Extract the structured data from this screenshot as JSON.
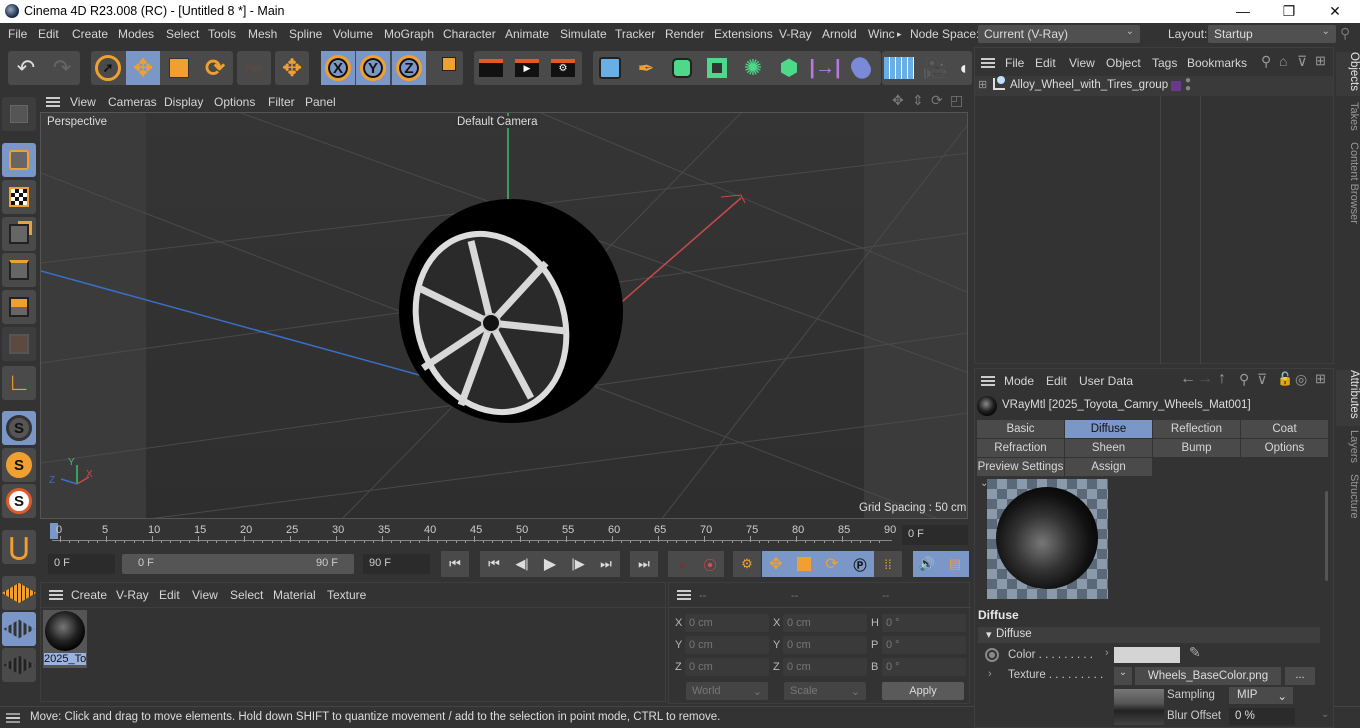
{
  "window": {
    "title": "Cinema 4D R23.008 (RC) - [Untitled 8 *] - Main",
    "minimize": "—",
    "maximize": "❐",
    "close": "✕"
  },
  "menubar": {
    "items": [
      "File",
      "Edit",
      "Create",
      "Modes",
      "Select",
      "Tools",
      "Mesh",
      "Spline",
      "Volume",
      "MoGraph",
      "Character",
      "Animate",
      "Simulate",
      "Tracker",
      "Render",
      "Extensions",
      "V-Ray",
      "Arnold",
      "Winc"
    ],
    "overflow_arrow": "▸",
    "node_space_label": "Node Space:",
    "node_space_value": "Current (V-Ray)",
    "layout_label": "Layout:",
    "layout_value": "Startup"
  },
  "toolbar": {
    "axis_x": "X",
    "axis_y": "Y",
    "axis_z": "Z",
    "psr": "PSR"
  },
  "viewport": {
    "menu": [
      "View",
      "Cameras",
      "Display",
      "Options",
      "Filter",
      "Panel"
    ],
    "view_name": "Perspective",
    "camera_name": "Default Camera",
    "grid_spacing": "Grid Spacing : 50 cm",
    "axis_labels": {
      "x": "X",
      "y": "Y",
      "z": "Z"
    },
    "colors": {
      "x_axis": "#c84a4a",
      "y_axis": "#3fbf6f",
      "z_axis": "#3a6fc8"
    }
  },
  "timeline": {
    "ticks": [
      "0",
      "5",
      "10",
      "15",
      "20",
      "25",
      "30",
      "35",
      "40",
      "45",
      "50",
      "55",
      "60",
      "65",
      "70",
      "75",
      "80",
      "85",
      "90"
    ],
    "current_frame_field": "0 F",
    "start_field": "0 F",
    "range_start": "0 F",
    "range_end": "90 F",
    "end_field": "90 F"
  },
  "material_manager": {
    "menu": [
      "Create",
      "V-Ray",
      "Edit",
      "View",
      "Select",
      "Material",
      "Texture"
    ],
    "materials": [
      {
        "label": "2025_To"
      }
    ]
  },
  "coordinates": {
    "headers": [
      "--",
      "--",
      "--"
    ],
    "rows": [
      {
        "l1": "X",
        "v1": "0 cm",
        "l2": "X",
        "v2": "0 cm",
        "l3": "H",
        "v3": "0 °"
      },
      {
        "l1": "Y",
        "v1": "0 cm",
        "l2": "Y",
        "v2": "0 cm",
        "l3": "P",
        "v3": "0 °"
      },
      {
        "l1": "Z",
        "v1": "0 cm",
        "l2": "Z",
        "v2": "0 cm",
        "l3": "B",
        "v3": "0 °"
      }
    ],
    "mode_select": "World",
    "size_select": "Scale",
    "apply": "Apply"
  },
  "objects_panel": {
    "menu": [
      "File",
      "Edit",
      "View",
      "Object",
      "Tags",
      "Bookmarks"
    ],
    "objects": [
      {
        "name": "Alloy_Wheel_with_Tires_group",
        "layer_color": "#6a3a8a"
      }
    ]
  },
  "side_tabs": {
    "top": [
      "Objects",
      "Takes",
      "Content Browser"
    ],
    "bottom": [
      "Attributes",
      "Layers",
      "Structure"
    ]
  },
  "attributes_panel": {
    "menu": [
      "Mode",
      "Edit",
      "User Data"
    ],
    "material_title": "VRayMtl [2025_Toyota_Camry_Wheels_Mat001]",
    "tabs": [
      {
        "label": "Basic",
        "selected": false
      },
      {
        "label": "Diffuse",
        "selected": true
      },
      {
        "label": "Reflection",
        "selected": false
      },
      {
        "label": "Coat",
        "selected": false
      },
      {
        "label": "Refraction",
        "selected": false
      },
      {
        "label": "Sheen",
        "selected": false
      },
      {
        "label": "Bump",
        "selected": false
      },
      {
        "label": "Options",
        "selected": false
      },
      {
        "label": "Preview Settings",
        "selected": false
      },
      {
        "label": "Assign",
        "selected": false
      }
    ],
    "section_title": "Diffuse",
    "group_title": "Diffuse",
    "color_label": "Color . . . . . . . . .",
    "color_value": "#d4d4d4",
    "texture_label": "Texture . . . . . . . . .",
    "texture_file": "Wheels_BaseColor.png",
    "texture_more": "...",
    "sampling_label": "Sampling",
    "sampling_value": "MIP",
    "blur_label": "Blur Offset",
    "blur_value": "0 %"
  },
  "statusbar": {
    "text": "Move: Click and drag to move elements. Hold down SHIFT to quantize movement / add to the selection in point mode, CTRL to remove."
  },
  "accent": {
    "selected": "#7a97c8",
    "orange": "#f0a030"
  }
}
